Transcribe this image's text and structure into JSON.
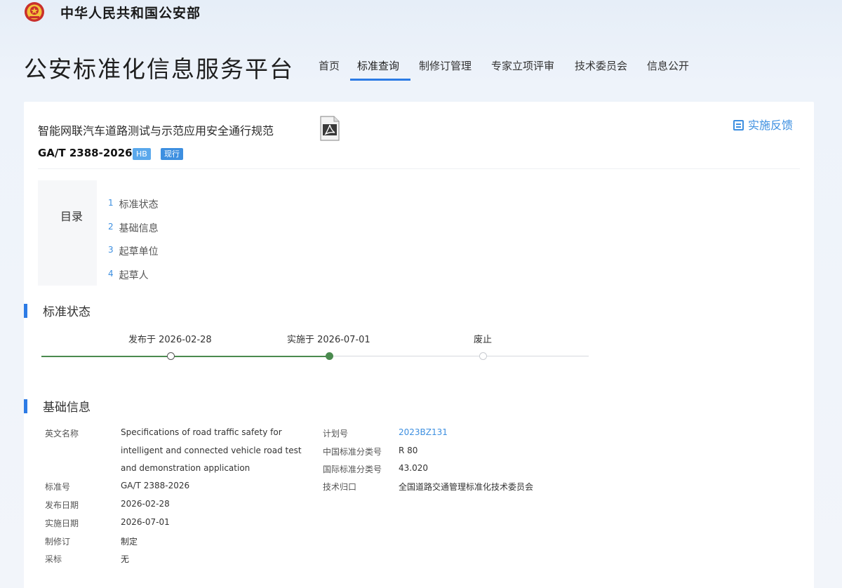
{
  "ministry": {
    "name": "中华人民共和国公安部"
  },
  "header": {
    "platform_title": "公安标准化信息服务平台",
    "nav": [
      "首页",
      "标准查询",
      "制修订管理",
      "专家立项评审",
      "技术委员会",
      "信息公开"
    ],
    "active_nav": "标准查询"
  },
  "document": {
    "title": "智能网联汽车道路测试与示范应用安全通行规范",
    "code": "GA/T 2388-2026",
    "tags": [
      "HB",
      "现行"
    ],
    "feedback_label": "实施反馈"
  },
  "toc": {
    "label": "目录",
    "items": [
      {
        "num": "1",
        "label": "标准状态"
      },
      {
        "num": "2",
        "label": "基础信息"
      },
      {
        "num": "3",
        "label": "起草单位"
      },
      {
        "num": "4",
        "label": "起草人"
      }
    ]
  },
  "status_section": {
    "heading": "标准状态",
    "timeline": [
      {
        "label": "发布于 2026-02-28",
        "state": "done"
      },
      {
        "label": "实施于 2026-07-01",
        "state": "current"
      },
      {
        "label": "废止",
        "state": "pending"
      }
    ]
  },
  "info_section": {
    "heading": "基础信息",
    "left": {
      "english_name_label": "英文名称",
      "english_name_lines": [
        "Specifications of road traffic safety for",
        "intelligent and connected vehicle road test",
        "and demonstration application"
      ],
      "standard_no_label": "标准号",
      "standard_no": "GA/T 2388-2026",
      "publish_date_label": "发布日期",
      "publish_date": "2026-02-28",
      "implement_date_label": "实施日期",
      "implement_date": "2026-07-01",
      "revision_label": "制修订",
      "revision": "制定",
      "adopt_label": "采标",
      "adopt": "无"
    },
    "right": {
      "plan_no_label": "计划号",
      "plan_no": "2023BZ131",
      "ccs_label": "中国标准分类号",
      "ccs": "R 80",
      "ics_label": "国际标准分类号",
      "ics": "43.020",
      "tc_label": "技术归口",
      "tc": "全国道路交通管理标准化技术委员会"
    }
  },
  "colors": {
    "accent": "#2c7be5",
    "timeline_done": "#4a8a4f",
    "link": "#3d8fe0"
  }
}
